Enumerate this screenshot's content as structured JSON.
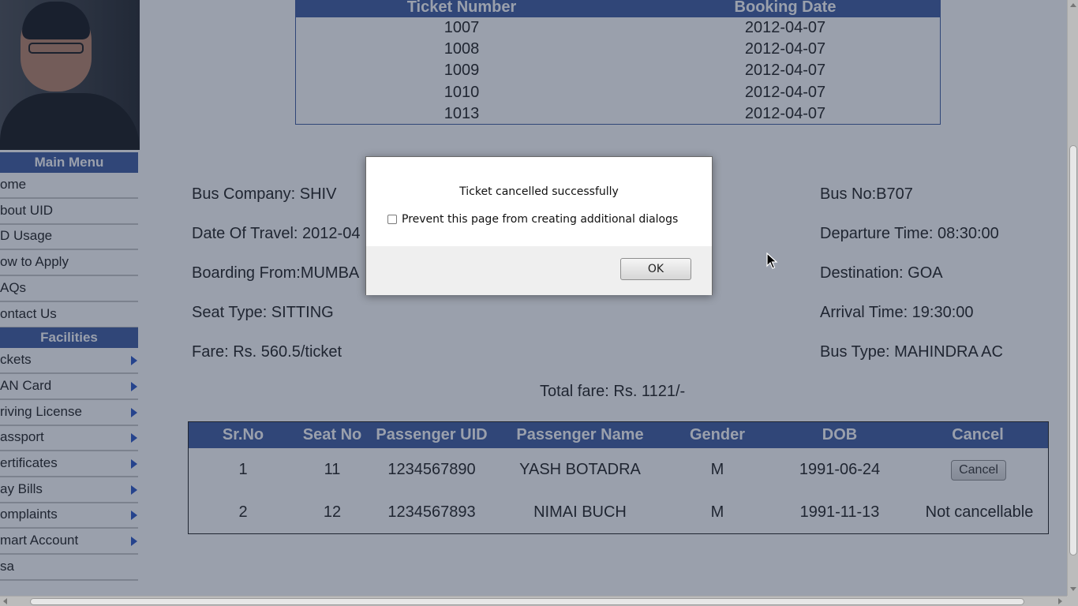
{
  "sidebar": {
    "menus": [
      {
        "title": "Main Menu",
        "items": [
          {
            "label": "ome",
            "arrow": false
          },
          {
            "label": "bout UID",
            "arrow": false
          },
          {
            "label": "D Usage",
            "arrow": false
          },
          {
            "label": "ow to Apply",
            "arrow": false
          },
          {
            "label": "AQs",
            "arrow": false
          },
          {
            "label": "ontact Us",
            "arrow": false
          }
        ]
      },
      {
        "title": "Facilities",
        "items": [
          {
            "label": "ckets",
            "arrow": true
          },
          {
            "label": "AN Card",
            "arrow": true
          },
          {
            "label": "riving License",
            "arrow": true
          },
          {
            "label": "assport",
            "arrow": true
          },
          {
            "label": "ertificates",
            "arrow": true
          },
          {
            "label": "ay Bills",
            "arrow": true
          },
          {
            "label": "omplaints",
            "arrow": true
          },
          {
            "label": "mart Account",
            "arrow": true
          },
          {
            "label": "sa",
            "arrow": false
          }
        ]
      }
    ]
  },
  "tickets": {
    "headers": [
      "Ticket Number",
      "Booking Date"
    ],
    "rows": [
      [
        "1007",
        "2012-04-07"
      ],
      [
        "1008",
        "2012-04-07"
      ],
      [
        "1009",
        "2012-04-07"
      ],
      [
        "1010",
        "2012-04-07"
      ],
      [
        "1013",
        "2012-04-07"
      ]
    ]
  },
  "journey": {
    "bus_company": "Bus Company: SHIV",
    "date_of_travel": "Date Of Travel: 2012-04",
    "boarding_from": "Boarding From:MUMBA",
    "seat_type": "Seat Type: SITTING",
    "fare": "Fare: Rs. 560.5/ticket",
    "bus_no": "Bus No:B707",
    "departure_time": "Departure Time: 08:30:00",
    "destination": "Destination: GOA",
    "arrival_time": "Arrival Time: 19:30:00",
    "bus_type": "Bus Type: MAHINDRA AC",
    "total_fare": "Total fare: Rs. 1121/-"
  },
  "passengers": {
    "headers": [
      "Sr.No",
      "Seat No",
      "Passenger UID",
      "Passenger Name",
      "Gender",
      "DOB",
      "Cancel"
    ],
    "rows": [
      {
        "sr": "1",
        "seat": "11",
        "uid": "1234567890",
        "name": "YASH BOTADRA",
        "gender": "M",
        "dob": "1991-06-24",
        "cancel": "Cancel",
        "cancel_is_button": true
      },
      {
        "sr": "2",
        "seat": "12",
        "uid": "1234567893",
        "name": "NIMAI BUCH",
        "gender": "M",
        "dob": "1991-11-13",
        "cancel": "Not cancellable",
        "cancel_is_button": false
      }
    ]
  },
  "dialog": {
    "message": "Ticket cancelled successfully",
    "checkbox_label": "Prevent this page from creating additional dialogs",
    "checkbox_checked": false,
    "ok_label": "OK"
  },
  "colors": {
    "accent": "#3e5ba0",
    "overlay": "#1e2d46"
  }
}
